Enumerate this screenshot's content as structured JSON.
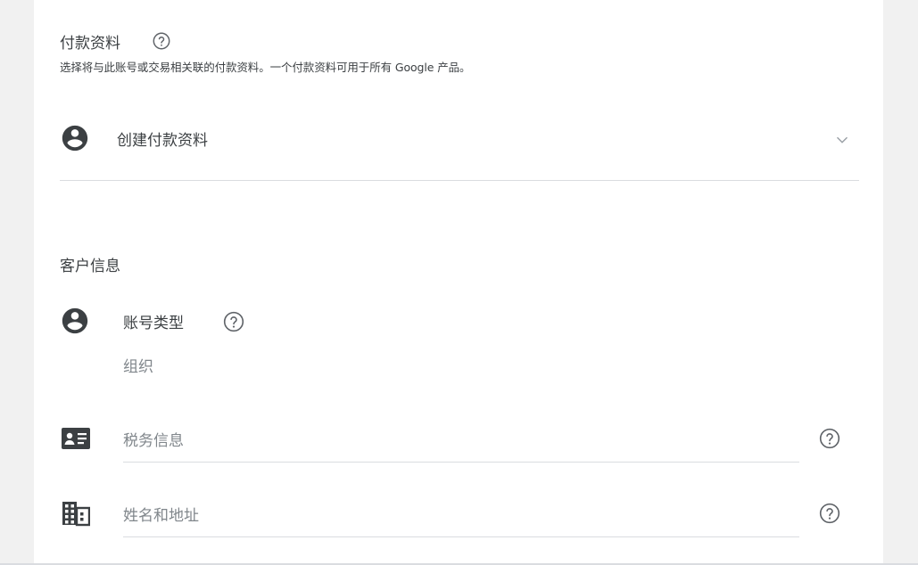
{
  "payment_profile": {
    "title": "付款资料",
    "description": "选择将与此账号或交易相关联的付款资料。一个付款资料可用于所有 Google 产品。",
    "selected": "创建付款资料"
  },
  "customer_info": {
    "title": "客户信息",
    "account_type": {
      "label": "账号类型",
      "value": "组织"
    },
    "tax_info": {
      "label": "税务信息"
    },
    "name_address": {
      "label": "姓名和地址"
    }
  },
  "icons": {
    "account": "account-circle-icon",
    "help": "help-outline-icon",
    "dropdown": "chevron-down-icon",
    "tax": "id-card-icon",
    "building": "business-icon"
  },
  "colors": {
    "icon": "#3c4043",
    "text": "#3c4043",
    "muted": "#80868b",
    "divider": "#dadce0",
    "background": "#f1f1f1"
  }
}
